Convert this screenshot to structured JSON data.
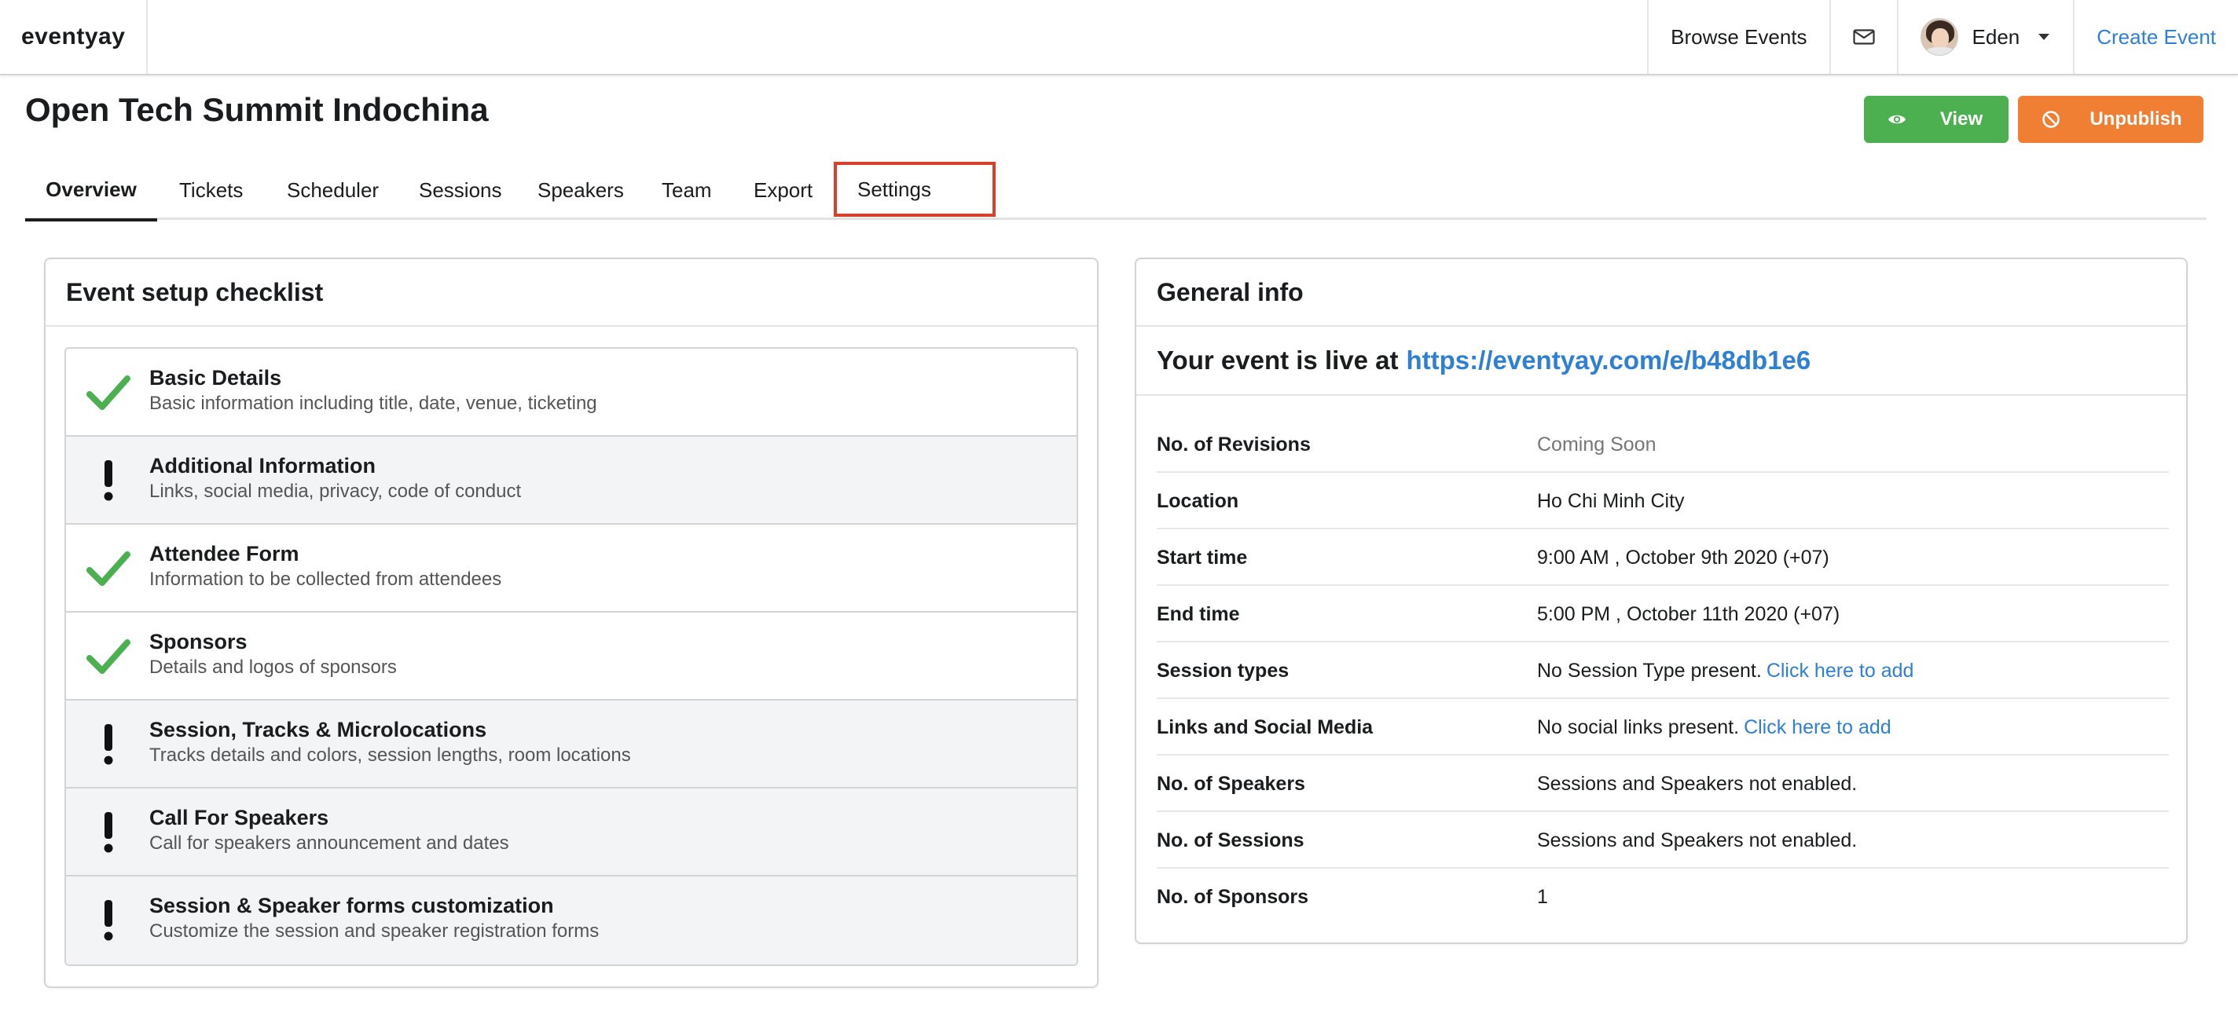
{
  "navbar": {
    "brand": "eventyay",
    "browse_events": "Browse Events",
    "user_name": "Eden",
    "create_event": "Create Event",
    "icons": {
      "mail": "mail-icon",
      "dropdown": "caret-down-icon"
    }
  },
  "header": {
    "event_title": "Open Tech Summit Indochina",
    "view_label": "View",
    "unpublish_label": "Unpublish",
    "colors": {
      "view": "#4caf50",
      "unpublish": "#f07f34",
      "highlight": "#d9402b",
      "link": "#2f80d2"
    }
  },
  "tabs": [
    {
      "label": "Overview",
      "active": true
    },
    {
      "label": "Tickets"
    },
    {
      "label": "Scheduler"
    },
    {
      "label": "Sessions"
    },
    {
      "label": "Speakers"
    },
    {
      "label": "Team"
    },
    {
      "label": "Export"
    },
    {
      "label": "Settings",
      "highlighted": true
    }
  ],
  "checklist": {
    "title": "Event setup checklist",
    "items": [
      {
        "title": "Basic Details",
        "desc": "Basic information including title, date, venue, ticketing",
        "status": "done"
      },
      {
        "title": "Additional Information",
        "desc": "Links, social media, privacy, code of conduct",
        "status": "pending"
      },
      {
        "title": "Attendee Form",
        "desc": "Information to be collected from attendees",
        "status": "done"
      },
      {
        "title": "Sponsors",
        "desc": "Details and logos of sponsors",
        "status": "done"
      },
      {
        "title": "Session, Tracks & Microlocations",
        "desc": "Tracks details and colors, session lengths, room locations",
        "status": "pending"
      },
      {
        "title": "Call For Speakers",
        "desc": "Call for speakers announcement and dates",
        "status": "pending"
      },
      {
        "title": "Session & Speaker forms customization",
        "desc": "Customize the session and speaker registration forms",
        "status": "pending"
      }
    ]
  },
  "general_info": {
    "title": "General info",
    "live_prefix": "Your event is live at",
    "live_url": "https://eventyay.com/e/b48db1e6",
    "rows": [
      {
        "key": "No. of Revisions",
        "value": "Coming Soon",
        "muted": true
      },
      {
        "key": "Location",
        "value": "Ho Chi Minh City"
      },
      {
        "key": "Start time",
        "value": "9:00 AM , October 9th 2020 (+07)"
      },
      {
        "key": "End time",
        "value": "5:00 PM , October 11th 2020 (+07)"
      },
      {
        "key": "Session types",
        "value": "No Session Type present.",
        "link": "Click here to add"
      },
      {
        "key": "Links and Social Media",
        "value": "No social links present.",
        "link": "Click here to add"
      },
      {
        "key": "No. of Speakers",
        "value": "Sessions and Speakers not enabled."
      },
      {
        "key": "No. of Sessions",
        "value": "Sessions and Speakers not enabled."
      },
      {
        "key": "No. of Sponsors",
        "value": "1"
      }
    ]
  }
}
